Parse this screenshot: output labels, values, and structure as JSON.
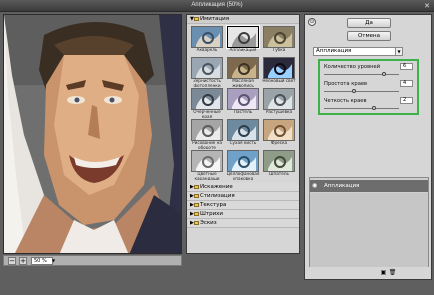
{
  "window": {
    "title": "Аппликация (50%)"
  },
  "preview": {
    "zoom_value": "50 %",
    "zoom_out": "−",
    "zoom_in": "+"
  },
  "gallery": {
    "open_folder": "Имитация",
    "thumbnails": [
      {
        "label": "Акварель"
      },
      {
        "label": "Аппликация"
      },
      {
        "label": "Губка"
      },
      {
        "label": "Зернистость фотопленки"
      },
      {
        "label": "Масляная живопись"
      },
      {
        "label": "Неоновый свет"
      },
      {
        "label": "Очерченные края"
      },
      {
        "label": "Пастель"
      },
      {
        "label": "Растушевка"
      },
      {
        "label": "Рисование на обороте"
      },
      {
        "label": "Сухая кисть"
      },
      {
        "label": "Фреска"
      },
      {
        "label": "Цветные карандаши"
      },
      {
        "label": "Целлофановая упаковка"
      },
      {
        "label": "Шпатель"
      }
    ],
    "folders": [
      "Искажение",
      "Стилизация",
      "Текстура",
      "Штрихи",
      "Эскиз"
    ]
  },
  "buttons": {
    "ok": "Да",
    "cancel": "Отмена"
  },
  "filter_select": {
    "value": "Аппликация"
  },
  "params": [
    {
      "label": "Количество уровней",
      "value": "6",
      "fraction": 0.8
    },
    {
      "label": "Простота краев",
      "value": "4",
      "fraction": 0.4
    },
    {
      "label": "Четкость краев",
      "value": "2",
      "fraction": 0.67
    }
  ],
  "layer": {
    "name": "Аппликация"
  },
  "colors": {
    "accent_highlight": "#3db14a",
    "selected_thumb_border": "#000000"
  }
}
